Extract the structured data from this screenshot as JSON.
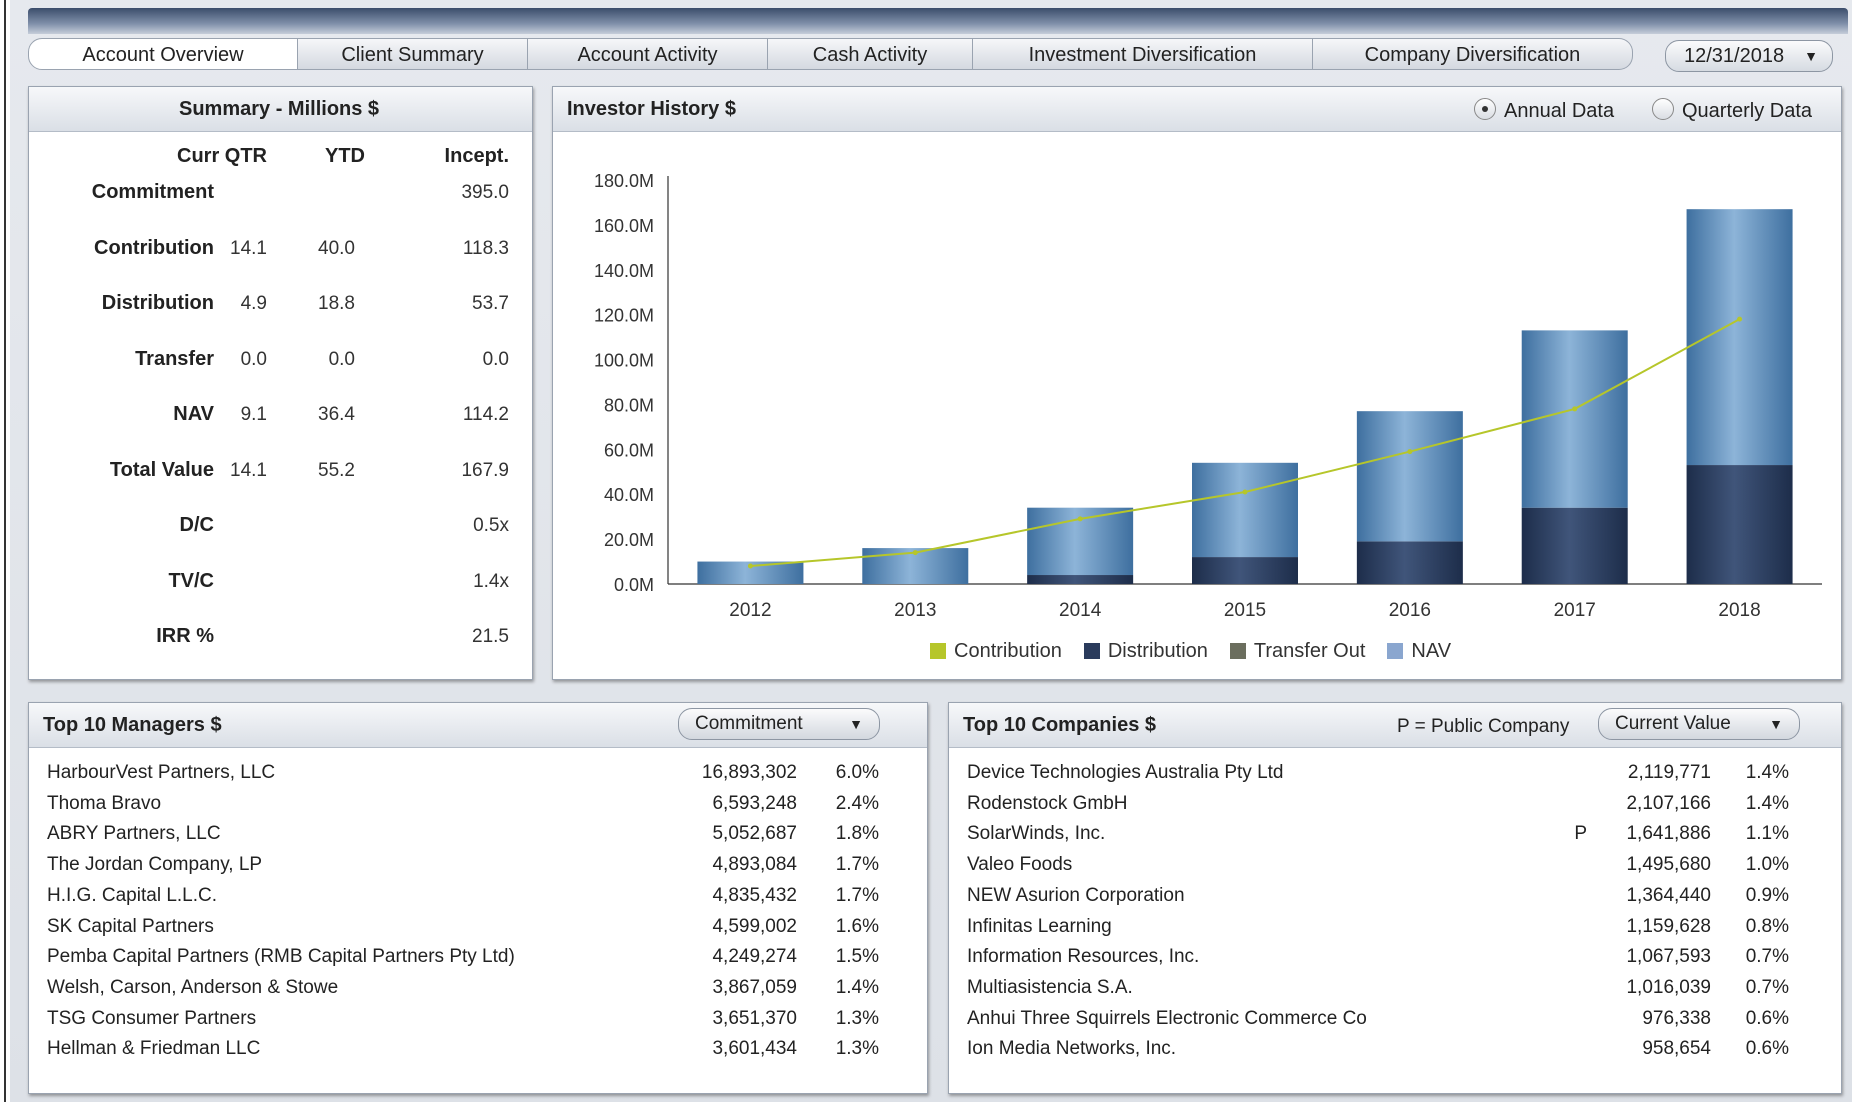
{
  "tabs": [
    "Account Overview",
    "Client Summary",
    "Account Activity",
    "Cash Activity",
    "Investment Diversification",
    "Company Diversification"
  ],
  "date_selector": "12/31/2018",
  "summary": {
    "title": "Summary - Millions  $",
    "columns": [
      "Curr QTR",
      "YTD",
      "Incept."
    ],
    "rows": [
      {
        "label": "Commitment",
        "curr": "",
        "ytd": "",
        "incept": "395.0"
      },
      {
        "label": "Contribution",
        "curr": "14.1",
        "ytd": "40.0",
        "incept": "118.3"
      },
      {
        "label": "Distribution",
        "curr": "4.9",
        "ytd": "18.8",
        "incept": "53.7"
      },
      {
        "label": "Transfer",
        "curr": "0.0",
        "ytd": "0.0",
        "incept": "0.0"
      },
      {
        "label": "NAV",
        "curr": "9.1",
        "ytd": "36.4",
        "incept": "114.2"
      },
      {
        "label": "Total Value",
        "curr": "14.1",
        "ytd": "55.2",
        "incept": "167.9"
      },
      {
        "label": "D/C",
        "curr": "",
        "ytd": "",
        "incept": "0.5x"
      },
      {
        "label": "TV/C",
        "curr": "",
        "ytd": "",
        "incept": "1.4x"
      },
      {
        "label": "IRR %",
        "curr": "",
        "ytd": "",
        "incept": "21.5"
      }
    ]
  },
  "investor_history": {
    "title": "Investor History  $",
    "radio_annual": "Annual Data",
    "radio_quarterly": "Quarterly Data",
    "selected": "annual"
  },
  "chart_data": {
    "type": "bar",
    "categories": [
      "2012",
      "2013",
      "2014",
      "2015",
      "2016",
      "2017",
      "2018"
    ],
    "ylim": [
      0,
      180
    ],
    "yticks": [
      "0.0M",
      "20.0M",
      "40.0M",
      "60.0M",
      "80.0M",
      "100.0M",
      "120.0M",
      "140.0M",
      "160.0M",
      "180.0M"
    ],
    "series": [
      {
        "name": "Contribution",
        "kind": "line",
        "color": "#b6c62a",
        "values": [
          8,
          14,
          29,
          41,
          59,
          78,
          118
        ]
      },
      {
        "name": "Distribution",
        "kind": "bar",
        "color": "#2a3b5c",
        "values": [
          0,
          0,
          4,
          12,
          19,
          34,
          53
        ]
      },
      {
        "name": "Transfer Out",
        "kind": "bar",
        "color": "#6b6e5e",
        "values": [
          0,
          0,
          0,
          0,
          0,
          0,
          0
        ]
      },
      {
        "name": "NAV",
        "kind": "bar",
        "color": "#5d8fc0",
        "values": [
          10,
          16,
          30,
          42,
          58,
          79,
          114
        ]
      }
    ],
    "legend": [
      "Contribution",
      "Distribution",
      "Transfer Out",
      "NAV"
    ]
  },
  "managers": {
    "title": "Top 10 Managers  $",
    "dropdown": "Commitment",
    "rows": [
      {
        "name": "HarbourVest Partners, LLC",
        "value": "16,893,302",
        "pct": "6.0%"
      },
      {
        "name": "Thoma Bravo",
        "value": "6,593,248",
        "pct": "2.4%"
      },
      {
        "name": "ABRY Partners, LLC",
        "value": "5,052,687",
        "pct": "1.8%"
      },
      {
        "name": "The Jordan Company, LP",
        "value": "4,893,084",
        "pct": "1.7%"
      },
      {
        "name": "H.I.G. Capital L.L.C.",
        "value": "4,835,432",
        "pct": "1.7%"
      },
      {
        "name": "SK Capital Partners",
        "value": "4,599,002",
        "pct": "1.6%"
      },
      {
        "name": "Pemba Capital Partners (RMB Capital Partners Pty Ltd)",
        "value": "4,249,274",
        "pct": "1.5%"
      },
      {
        "name": "Welsh, Carson, Anderson & Stowe",
        "value": "3,867,059",
        "pct": "1.4%"
      },
      {
        "name": "TSG Consumer Partners",
        "value": "3,651,370",
        "pct": "1.3%"
      },
      {
        "name": "Hellman & Friedman LLC",
        "value": "3,601,434",
        "pct": "1.3%"
      }
    ]
  },
  "companies": {
    "title": "Top 10 Companies  $",
    "note": "P = Public Company",
    "dropdown": "Current Value",
    "rows": [
      {
        "name": "Device Technologies Australia Pty Ltd",
        "flag": "",
        "value": "2,119,771",
        "pct": "1.4%"
      },
      {
        "name": "Rodenstock GmbH",
        "flag": "",
        "value": "2,107,166",
        "pct": "1.4%"
      },
      {
        "name": "SolarWinds, Inc.",
        "flag": "P",
        "value": "1,641,886",
        "pct": "1.1%"
      },
      {
        "name": "Valeo Foods",
        "flag": "",
        "value": "1,495,680",
        "pct": "1.0%"
      },
      {
        "name": "NEW Asurion Corporation",
        "flag": "",
        "value": "1,364,440",
        "pct": "0.9%"
      },
      {
        "name": "Infinitas Learning",
        "flag": "",
        "value": "1,159,628",
        "pct": "0.8%"
      },
      {
        "name": "Information Resources, Inc.",
        "flag": "",
        "value": "1,067,593",
        "pct": "0.7%"
      },
      {
        "name": "Multiasistencia S.A.",
        "flag": "",
        "value": "1,016,039",
        "pct": "0.7%"
      },
      {
        "name": "Anhui Three Squirrels Electronic Commerce Co",
        "flag": "",
        "value": "976,338",
        "pct": "0.6%"
      },
      {
        "name": "Ion Media Networks, Inc.",
        "flag": "",
        "value": "958,654",
        "pct": "0.6%"
      }
    ]
  }
}
